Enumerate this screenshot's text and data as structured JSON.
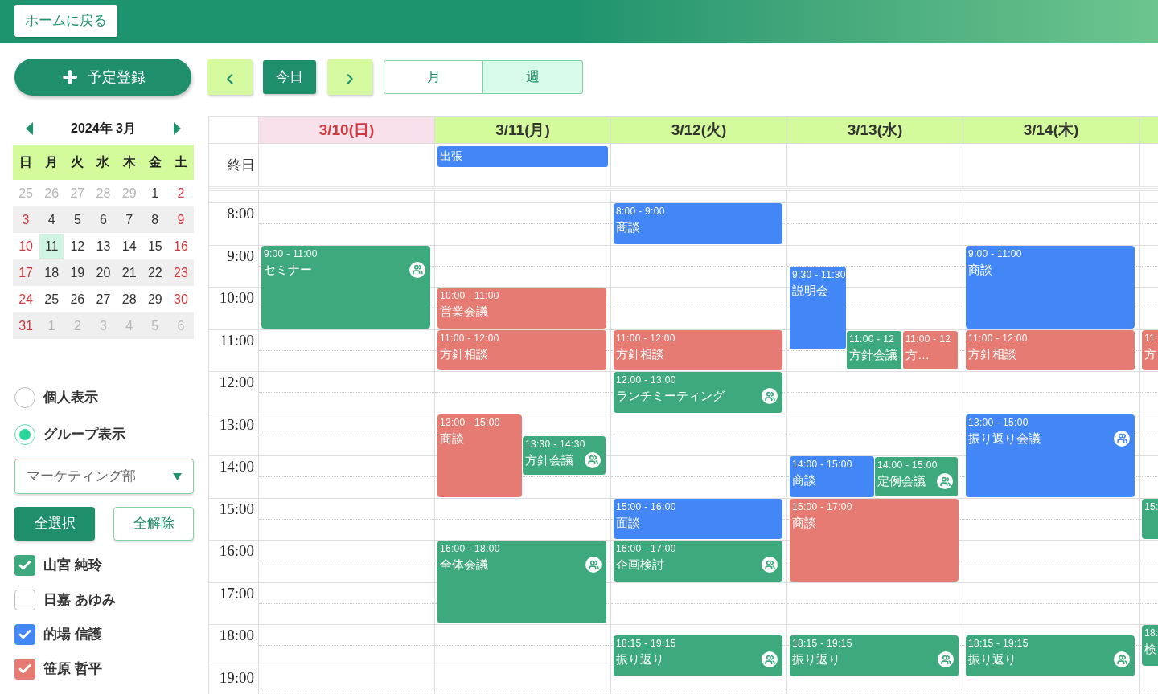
{
  "top_bar": {
    "home_button": "ホームに戻る"
  },
  "toolbar": {
    "add_button": "予定登録",
    "prev": "‹",
    "today": "今日",
    "next": "›",
    "views": [
      {
        "label": "月",
        "selected": false
      },
      {
        "label": "週",
        "selected": true
      }
    ]
  },
  "mini_calendar": {
    "title": "2024年 3月",
    "weekdays": [
      "日",
      "月",
      "火",
      "水",
      "木",
      "金",
      "土"
    ],
    "weeks": [
      [
        {
          "d": "25",
          "other": true,
          "selected": false
        },
        {
          "d": "26",
          "other": true,
          "selected": false
        },
        {
          "d": "27",
          "other": true,
          "selected": false
        },
        {
          "d": "28",
          "other": true,
          "selected": false
        },
        {
          "d": "29",
          "other": true,
          "selected": false
        },
        {
          "d": "1",
          "other": false,
          "selected": false
        },
        {
          "d": "2",
          "other": false,
          "selected": false
        }
      ],
      [
        {
          "d": "3",
          "other": false,
          "selected": false
        },
        {
          "d": "4",
          "other": false,
          "selected": false
        },
        {
          "d": "5",
          "other": false,
          "selected": false
        },
        {
          "d": "6",
          "other": false,
          "selected": false
        },
        {
          "d": "7",
          "other": false,
          "selected": false
        },
        {
          "d": "8",
          "other": false,
          "selected": false
        },
        {
          "d": "9",
          "other": false,
          "selected": false
        }
      ],
      [
        {
          "d": "10",
          "other": false,
          "selected": false
        },
        {
          "d": "11",
          "other": false,
          "selected": true
        },
        {
          "d": "12",
          "other": false,
          "selected": false
        },
        {
          "d": "13",
          "other": false,
          "selected": false
        },
        {
          "d": "14",
          "other": false,
          "selected": false
        },
        {
          "d": "15",
          "other": false,
          "selected": false
        },
        {
          "d": "16",
          "other": false,
          "selected": false
        }
      ],
      [
        {
          "d": "17",
          "other": false,
          "selected": false
        },
        {
          "d": "18",
          "other": false,
          "selected": false
        },
        {
          "d": "19",
          "other": false,
          "selected": false
        },
        {
          "d": "20",
          "other": false,
          "selected": false
        },
        {
          "d": "21",
          "other": false,
          "selected": false
        },
        {
          "d": "22",
          "other": false,
          "selected": false
        },
        {
          "d": "23",
          "other": false,
          "selected": false
        }
      ],
      [
        {
          "d": "24",
          "other": false,
          "selected": false
        },
        {
          "d": "25",
          "other": false,
          "selected": false
        },
        {
          "d": "26",
          "other": false,
          "selected": false
        },
        {
          "d": "27",
          "other": false,
          "selected": false
        },
        {
          "d": "28",
          "other": false,
          "selected": false
        },
        {
          "d": "29",
          "other": false,
          "selected": false
        },
        {
          "d": "30",
          "other": false,
          "selected": false
        }
      ],
      [
        {
          "d": "31",
          "other": false,
          "selected": false
        },
        {
          "d": "1",
          "other": true,
          "selected": false
        },
        {
          "d": "2",
          "other": true,
          "selected": false
        },
        {
          "d": "3",
          "other": true,
          "selected": false
        },
        {
          "d": "4",
          "other": true,
          "selected": false
        },
        {
          "d": "5",
          "other": true,
          "selected": false
        },
        {
          "d": "6",
          "other": true,
          "selected": false
        }
      ]
    ]
  },
  "view_mode": [
    {
      "label": "個人表示",
      "selected": false
    },
    {
      "label": "グループ表示",
      "selected": true
    }
  ],
  "group_select": {
    "value": "マーケティング部"
  },
  "select_buttons": {
    "select_all": "全選択",
    "clear_all": "全解除"
  },
  "members": [
    {
      "name": "山宮 純玲",
      "checked": true,
      "color": "#3ea97c"
    },
    {
      "name": "日嘉 あゆみ",
      "checked": false
    },
    {
      "name": "的場 信護",
      "checked": true,
      "color": "#4287f5"
    },
    {
      "name": "笹原 哲平",
      "checked": true,
      "color": "#e67b73"
    }
  ],
  "calendar": {
    "all_day_label": "終日",
    "hours": [
      "8:00",
      "9:00",
      "10:00",
      "11:00",
      "12:00",
      "13:00",
      "14:00",
      "15:00",
      "16:00",
      "17:00",
      "18:00",
      "19:00"
    ],
    "days": [
      {
        "label": "3/10(日)",
        "kind": "sunday",
        "events": [
          {
            "time": "9:00 - 11:00",
            "title": "セミナー",
            "color": "#3ea97c",
            "group": true
          }
        ]
      },
      {
        "label": "3/11(月)",
        "kind": "weekday",
        "all_day": [
          {
            "title": "出張",
            "color": "#4287f5"
          }
        ],
        "events": [
          {
            "time": "10:00 - 11:00",
            "title": "営業会議",
            "color": "#e67b73",
            "group": false
          },
          {
            "time": "11:00 - 12:00",
            "title": "方針相談",
            "color": "#e67b73",
            "group": false
          },
          {
            "time": "13:00 - 15:00",
            "title": "商談",
            "color": "#e67b73",
            "group": false
          },
          {
            "time": "13:30 - 14:30",
            "title": "方針会議",
            "color": "#3ea97c",
            "group": true
          },
          {
            "time": "16:00 - 18:00",
            "title": "全体会議",
            "color": "#3ea97c",
            "group": true
          }
        ]
      },
      {
        "label": "3/12(火)",
        "kind": "weekday",
        "events": [
          {
            "time": "8:00 - 9:00",
            "title": "商談",
            "color": "#4287f5",
            "group": false
          },
          {
            "time": "11:00 - 12:00",
            "title": "方針相談",
            "color": "#e67b73",
            "group": false
          },
          {
            "time": "12:00 - 13:00",
            "title": "ランチミーティング",
            "color": "#3ea97c",
            "group": true
          },
          {
            "time": "15:00 - 16:00",
            "title": "面談",
            "color": "#4287f5",
            "group": false
          },
          {
            "time": "16:00 - 17:00",
            "title": "企画検討",
            "color": "#3ea97c",
            "group": true
          },
          {
            "time": "18:15 - 19:15",
            "title": "振り返り",
            "color": "#3ea97c",
            "group": true
          }
        ]
      },
      {
        "label": "3/13(水)",
        "kind": "weekday",
        "events": [
          {
            "time": "9:30 - 11:30",
            "title": "説明会",
            "color": "#4287f5",
            "group": false
          },
          {
            "time": "11:00 - 12",
            "title": "方針会議",
            "color": "#3ea97c",
            "group": false
          },
          {
            "time": "11:00 - 12",
            "title": "方…",
            "color": "#e67b73",
            "group": false
          },
          {
            "time": "14:00 - 15:00",
            "title": "商談",
            "color": "#4287f5",
            "group": false
          },
          {
            "time": "14:00 - 15:00",
            "title": "定例会議",
            "color": "#3ea97c",
            "group": true
          },
          {
            "time": "15:00 - 17:00",
            "title": "商談",
            "color": "#e67b73",
            "group": false
          },
          {
            "time": "18:15 - 19:15",
            "title": "振り返り",
            "color": "#3ea97c",
            "group": true
          }
        ]
      },
      {
        "label": "3/14(木)",
        "kind": "weekday",
        "events": [
          {
            "time": "9:00 - 11:00",
            "title": "商談",
            "color": "#4287f5",
            "group": false
          },
          {
            "time": "11:00 - 12:00",
            "title": "方針相談",
            "color": "#e67b73",
            "group": false
          },
          {
            "time": "13:00 - 15:00",
            "title": "振り返り会議",
            "color": "#4287f5",
            "group": true
          },
          {
            "time": "18:15 - 19:15",
            "title": "振り返り",
            "color": "#3ea97c",
            "group": true
          }
        ]
      },
      {
        "kind": "weekday",
        "events": [
          {
            "time": "11:",
            "title": "方",
            "color": "#e67b73",
            "group": false
          },
          {
            "time": "15:",
            "color": "#3ea97c",
            "group": false
          },
          {
            "time": "18:",
            "title": "検",
            "color": "#3ea97c",
            "group": false
          }
        ]
      }
    ]
  }
}
